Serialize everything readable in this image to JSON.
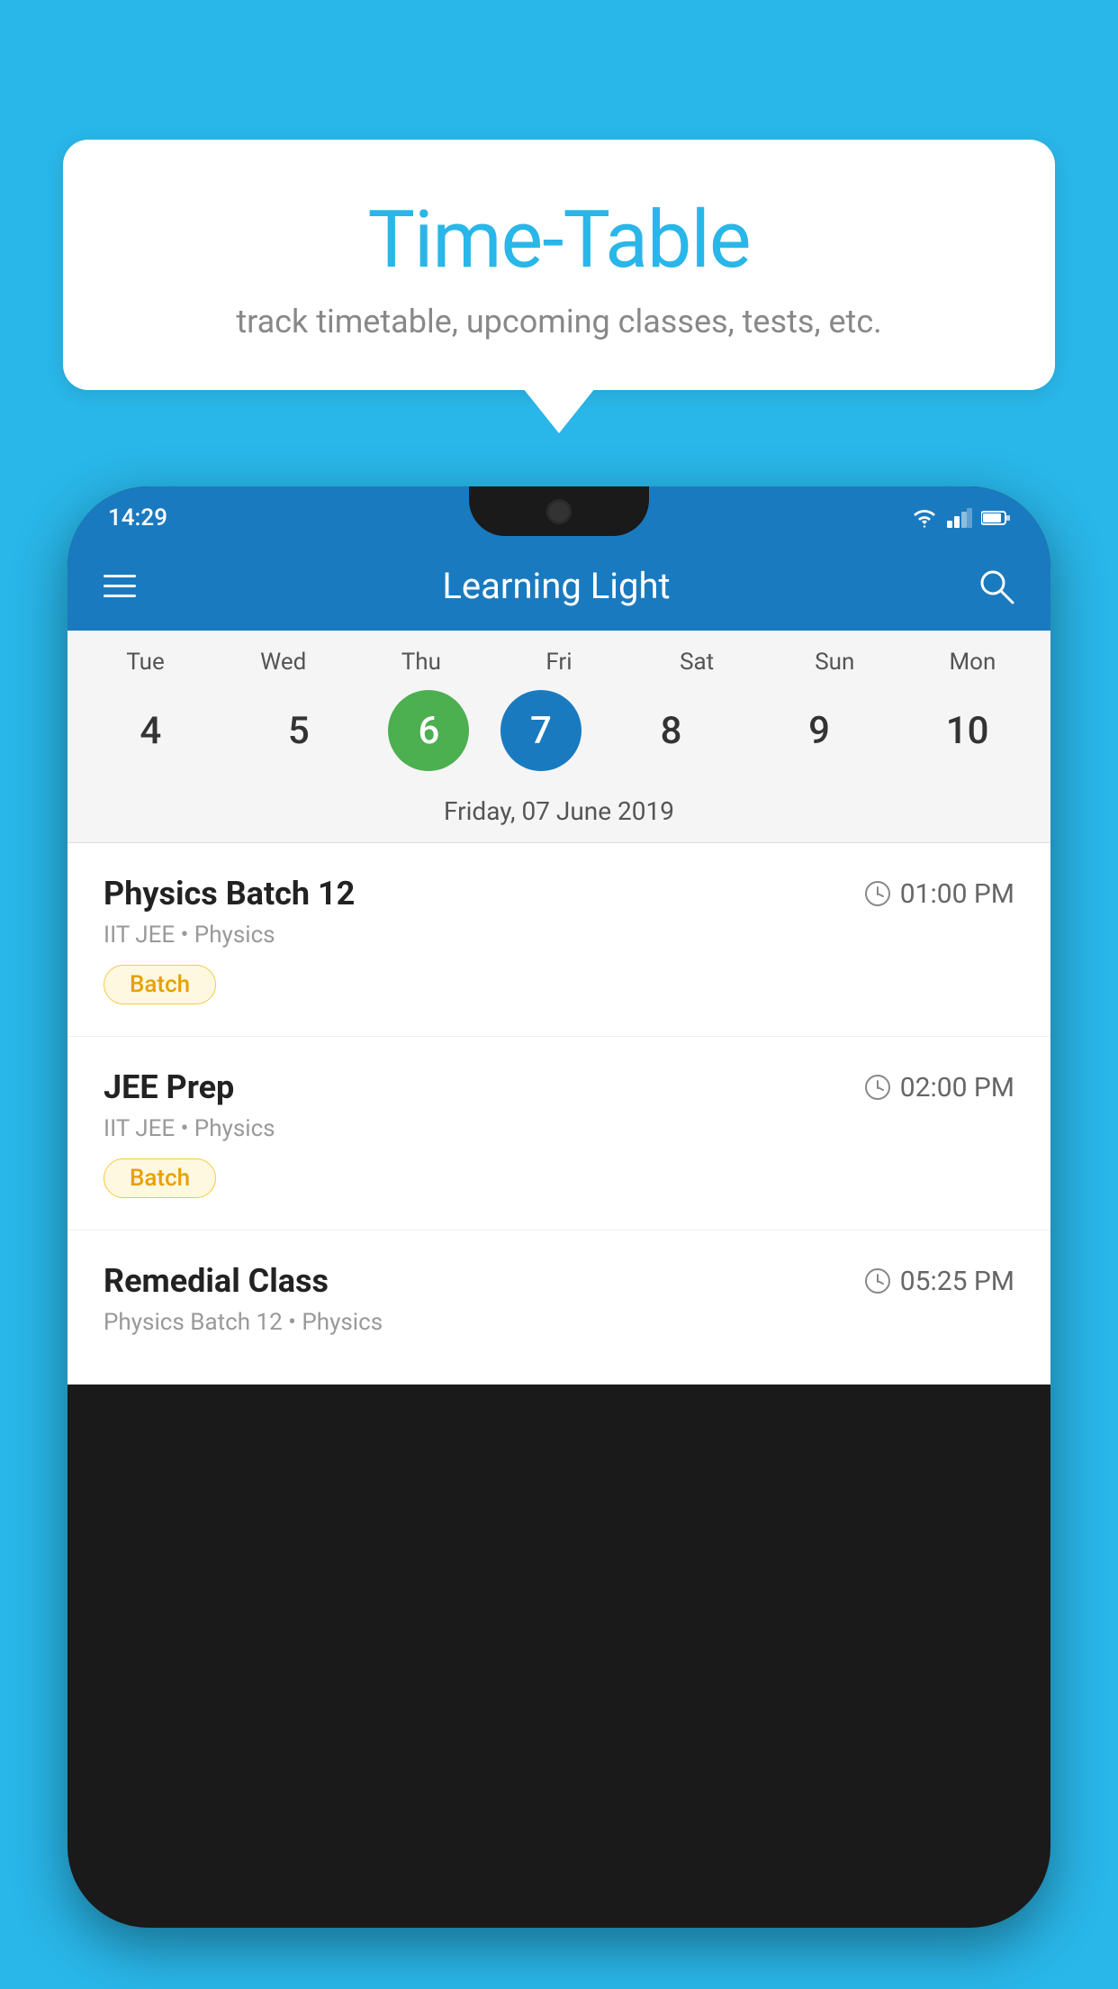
{
  "background_color": "#29b6e8",
  "bubble": {
    "title": "Time-Table",
    "subtitle": "track timetable, upcoming classes, tests, etc."
  },
  "phone": {
    "status_bar": {
      "time": "14:29"
    },
    "header": {
      "title": "Learning Light",
      "menu_icon": "menu",
      "search_icon": "search"
    },
    "calendar": {
      "days": [
        "Tue",
        "Wed",
        "Thu",
        "Fri",
        "Sat",
        "Sun",
        "Mon"
      ],
      "dates": [
        {
          "num": "4",
          "state": "normal"
        },
        {
          "num": "5",
          "state": "normal"
        },
        {
          "num": "6",
          "state": "today"
        },
        {
          "num": "7",
          "state": "selected"
        },
        {
          "num": "8",
          "state": "normal"
        },
        {
          "num": "9",
          "state": "normal"
        },
        {
          "num": "10",
          "state": "normal"
        }
      ],
      "selected_date_label": "Friday, 07 June 2019"
    },
    "schedule": [
      {
        "title": "Physics Batch 12",
        "time": "01:00 PM",
        "subtitle": "IIT JEE • Physics",
        "badge": "Batch"
      },
      {
        "title": "JEE Prep",
        "time": "02:00 PM",
        "subtitle": "IIT JEE • Physics",
        "badge": "Batch"
      },
      {
        "title": "Remedial Class",
        "time": "05:25 PM",
        "subtitle": "Physics Batch 12 • Physics",
        "badge": ""
      }
    ]
  }
}
